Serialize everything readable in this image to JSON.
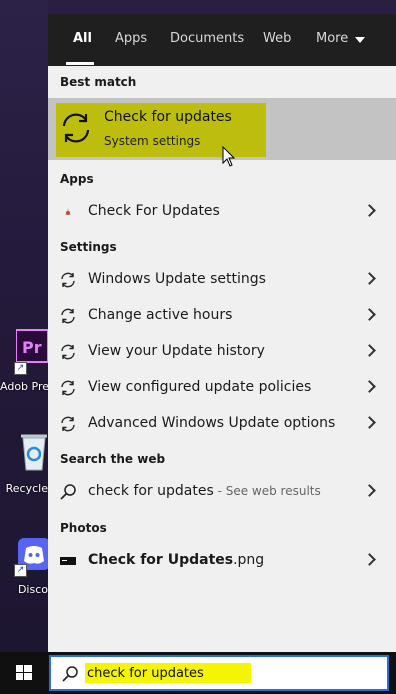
{
  "tabs": [
    "All",
    "Apps",
    "Documents",
    "Web",
    "More"
  ],
  "sections": {
    "best_match": "Best match",
    "apps": "Apps",
    "settings": "Settings",
    "search_web": "Search the web",
    "photos": "Photos"
  },
  "best_match": {
    "title": "Check for updates",
    "subtitle": "System settings"
  },
  "apps": [
    {
      "label": "Check For Updates"
    }
  ],
  "settings": [
    {
      "label": "Windows Update settings"
    },
    {
      "label": "Change active hours"
    },
    {
      "label": "View your Update history"
    },
    {
      "label": "View configured update policies"
    },
    {
      "label": "Advanced Windows Update options"
    }
  ],
  "web": {
    "query": "check for updates",
    "suffix": " - See web results"
  },
  "photos": [
    {
      "bold": "Check for Updates",
      "ext": ".png"
    }
  ],
  "search": {
    "value": "check for updates"
  },
  "desktop_icons": [
    {
      "label": "Adob Premiere",
      "icon": "premiere-icon",
      "color": "#e77ff9"
    },
    {
      "label": "Recycle",
      "icon": "recycle-bin-icon"
    },
    {
      "label": "Disco",
      "icon": "discord-icon",
      "color": "#5865f2"
    }
  ],
  "colors": {
    "highlight": "#bdbd0e",
    "search_highlight": "#f5f500",
    "selected_row": "#c3c3c3"
  }
}
